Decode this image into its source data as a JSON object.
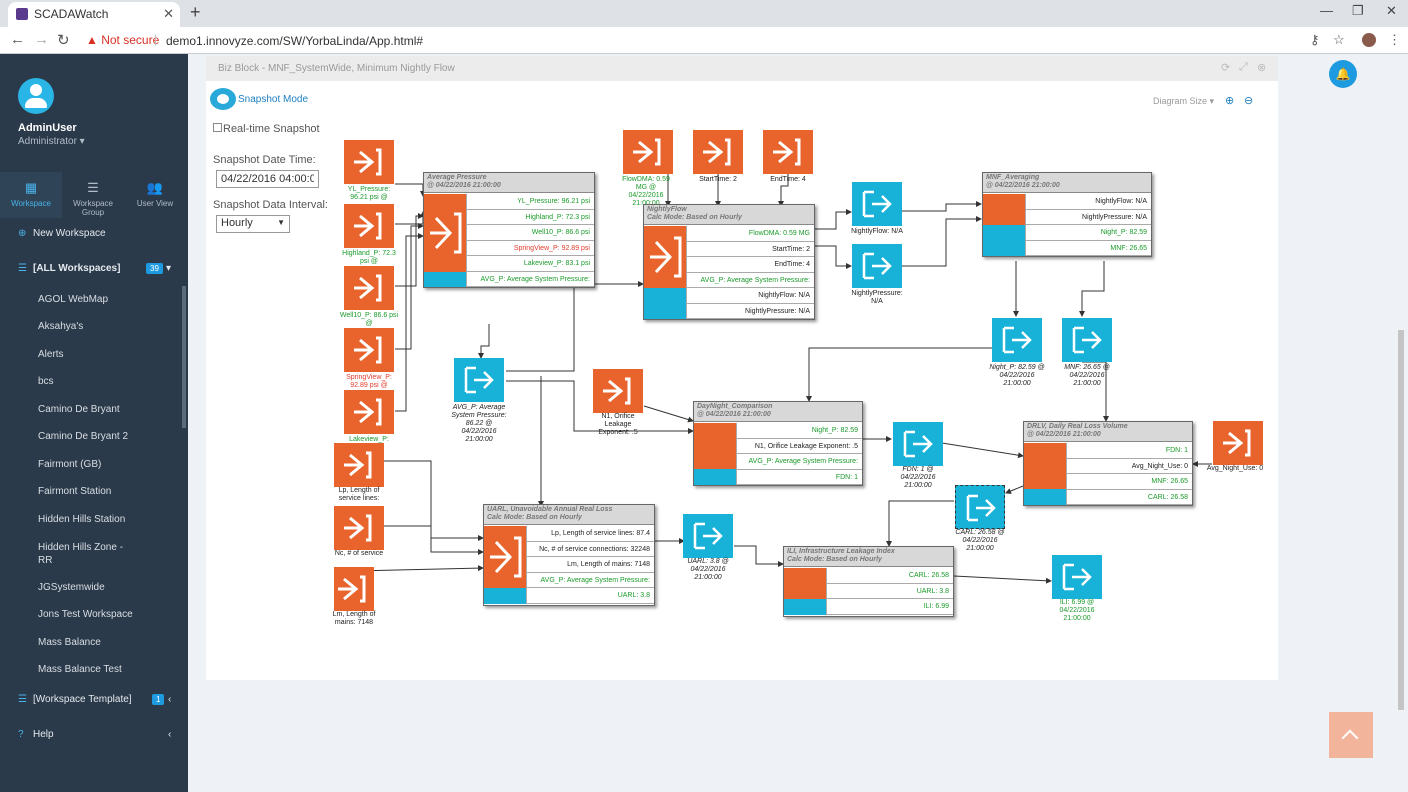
{
  "browser": {
    "tab_title": "SCADAWatch",
    "security": "Not secure",
    "url": "demo1.innovyze.com/SW/YorbaLinda/App.html#"
  },
  "sidebar": {
    "user_name": "AdminUser",
    "user_role": "Administrator",
    "tabs": [
      "Workspace",
      "Workspace Group",
      "User View"
    ],
    "new_workspace": "New Workspace",
    "all_workspaces": "[ALL Workspaces]",
    "all_count": "39",
    "workspaces": [
      "AGOL WebMap",
      "Aksahya's",
      "Alerts",
      "bcs",
      "Camino De Bryant",
      "Camino De Bryant 2",
      "Fairmont (GB)",
      "Fairmont Station",
      "Hidden Hills Station",
      "Hidden Hills Zone -",
      "RR",
      "JGSystemwide",
      "Jons Test Workspace",
      "Mass Balance",
      "Mass Balance Test"
    ],
    "template": "[Workspace Template]",
    "template_count": "1",
    "help": "Help"
  },
  "panel": {
    "title": "Biz Block - MNF_SystemWide, Minimum Nightly Flow",
    "snapshot_mode": "Snapshot Mode",
    "realtime_snapshot": "Real-time Snapshot",
    "snapshot_date_label": "Snapshot Date Time:",
    "snapshot_date_value": "04/22/2016 04:00:0",
    "interval_label": "Snapshot Data Interval:",
    "interval_value": "Hourly",
    "diagram_size": "Diagram Size"
  },
  "colors": {
    "orange": "#e8642c",
    "blue": "#18b2d8",
    "green": "#1a9a2a",
    "red": "#e23b2b"
  },
  "nodes": {
    "yl": "YL_Pressure: 96.21 psi @",
    "highland": "Highland_P: 72.3 psi @",
    "well10": "Well10_P: 86.6 psi @",
    "springview": "SpringView_P: 92.89 psi @",
    "lakeview": "Lakeview_P:",
    "flowdma": "FlowDMA: 0.59 MG @ 04/22/2016 21:00:00",
    "starttime": "StartTime: 2",
    "endtime": "EndTime: 4",
    "nightlyflow": "NightlyFlow: N/A",
    "nightlypressure": "NightlyPressure: N/A",
    "avgp": "AVG_P: Average System Pressure: 86.22 @ 04/22/2016 21:00:00",
    "n1": "N1, Orifice Leakage Exponent: .5",
    "nightp": "Night_P: 82.59 @ 04/22/2016 21:00:00",
    "mnf": "MNF: 26.65 @ 04/22/2016 21:00:00",
    "fdn": "FDN: 1 @ 04/22/2016 21:00:00",
    "carl": "CARL: 26.58 @ 04/22/2016 21:00:00",
    "avgnightuse": "Avg_Night_Use: 0",
    "lp": "Lp, Length of service lines:",
    "nc": "Nc, # of service",
    "lm": "Lm, Length of mains: 7148",
    "uarl": "UARL: 3.8 @ 04/22/2016 21:00:00",
    "ili": "ILI: 6.99 @ 04/22/2016 21:00:00"
  },
  "blocks": {
    "avgpressure": {
      "head": [
        "Average Pressure",
        "@ 04/22/2016 21:00:00"
      ],
      "rows": [
        "YL_Pressure: 96.21 psi",
        "Highland_P: 72.3 psi",
        "Well10_P: 86.6 psi",
        "SpringView_P: 92.89 psi",
        "Lakeview_P: 83.1 psi",
        "AVG_P: Average System Pressure:"
      ]
    },
    "nightlyflow": {
      "head": [
        "NightlyFlow",
        "Calc Mode: Based on Hourly"
      ],
      "rows": [
        "FlowDMA: 0.59 MG",
        "StartTime: 2",
        "EndTime: 4",
        "AVG_P: Average System Pressure:",
        "NightlyFlow: N/A",
        "NightlyPressure: N/A"
      ]
    },
    "mnfavg": {
      "head": [
        "MNF_Averaging",
        "@ 04/22/2016 21:00:00"
      ],
      "rows": [
        "NightlyFlow: N/A",
        "NightlyPressure: N/A",
        "Night_P: 82.59",
        "MNF: 26.65"
      ]
    },
    "daynight": {
      "head": [
        "DayNight_Comparison",
        "@ 04/22/2016 21:00:00"
      ],
      "rows": [
        "Night_P: 82.59",
        "N1, Orifice Leakage Exponent: .5",
        "AVG_P: Average System Pressure:",
        "FDN: 1"
      ]
    },
    "drlv": {
      "head": [
        "DRLV, Daily Real Loss Volume",
        "@ 04/22/2016 21:00:00"
      ],
      "rows": [
        "FDN: 1",
        "Avg_Night_Use: 0",
        "MNF: 26.65",
        "CARL: 26.58"
      ]
    },
    "uarl": {
      "head": [
        "UARL, Unavoidable Annual Real Loss",
        "Calc Mode: Based on Hourly"
      ],
      "rows": [
        "Lp, Length of service lines: 87.4",
        "Nc, # of service connections: 32248",
        "Lm, Length of mains: 7148",
        "AVG_P: Average System Pressure:",
        "UARL: 3.8"
      ]
    },
    "ili": {
      "head": [
        "ILI, Infrastructure Leakage Index",
        "Calc Mode: Based on Hourly"
      ],
      "rows": [
        "CARL: 26.58",
        "UARL: 3.8",
        "ILI: 6.99"
      ]
    }
  }
}
